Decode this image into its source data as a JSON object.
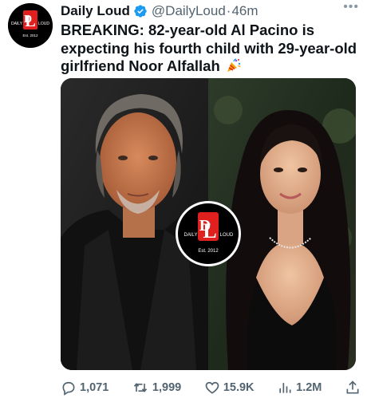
{
  "account": {
    "display_name": "Daily Loud",
    "handle": "@DailyLoud",
    "separator": "·",
    "time": "46m",
    "avatar_logo": {
      "letters": "DL",
      "left_word": "DAILY",
      "right_word": "LOUD",
      "est": "Est. 2012"
    }
  },
  "tweet": {
    "text": "BREAKING: 82-year-old Al Pacino is expecting his fourth child with 29-year-old girlfriend Noor Alfallah",
    "emoji": "party-popper-icon"
  },
  "media": {
    "watermark": {
      "letters": "DL",
      "left_word": "DAILY",
      "right_word": "LOUD",
      "est": "Est. 2012"
    }
  },
  "actions": {
    "replies": "1,071",
    "retweets": "1,999",
    "likes": "15.9K",
    "views": "1.2M"
  },
  "colors": {
    "brand_red": "#e0201e",
    "text": "#0f1419",
    "secondary": "#536471",
    "verified": "#1d9bf0"
  }
}
